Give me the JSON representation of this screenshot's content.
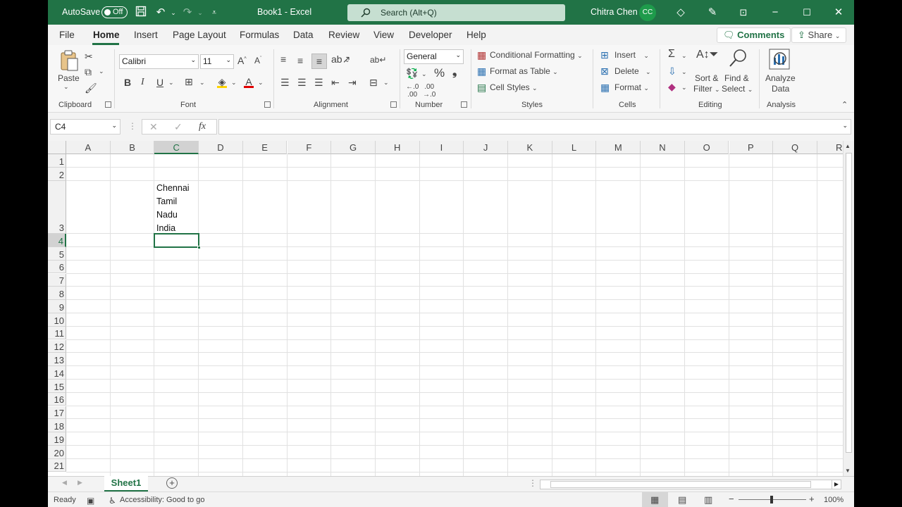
{
  "titlebar": {
    "autosave_label": "AutoSave",
    "autosave_state": "Off",
    "document_title": "Book1  -  Excel",
    "search_placeholder": "Search (Alt+Q)",
    "user_name": "Chitra Chen",
    "user_initials": "CC",
    "accent_color": "#217346"
  },
  "tabs": {
    "items": [
      "File",
      "Home",
      "Insert",
      "Page Layout",
      "Formulas",
      "Data",
      "Review",
      "View",
      "Developer",
      "Help"
    ],
    "active": "Home",
    "comments_label": "Comments",
    "share_label": "Share"
  },
  "ribbon": {
    "clipboard": {
      "paste": "Paste",
      "label": "Clipboard"
    },
    "font": {
      "family": "Calibri",
      "size": "11",
      "label": "Font",
      "bold": "B",
      "italic": "I",
      "underline": "U"
    },
    "alignment": {
      "label": "Alignment"
    },
    "number": {
      "format": "General",
      "label": "Number"
    },
    "styles": {
      "conditional": "Conditional Formatting",
      "format_table": "Format as Table",
      "cell_styles": "Cell Styles",
      "label": "Styles"
    },
    "cells": {
      "insert": "Insert",
      "delete": "Delete",
      "format": "Format",
      "label": "Cells"
    },
    "editing": {
      "sort1": "Sort &",
      "sort2": "Filter",
      "find1": "Find &",
      "find2": "Select",
      "label": "Editing"
    },
    "analysis": {
      "analyze1": "Analyze",
      "analyze2": "Data",
      "label": "Analysis"
    }
  },
  "formula_bar": {
    "name_box": "C4",
    "cancel": "✕",
    "enter": "✓",
    "fx": "fx",
    "formula": ""
  },
  "grid": {
    "columns": [
      "A",
      "B",
      "C",
      "D",
      "E",
      "F",
      "G",
      "H",
      "I",
      "J",
      "K",
      "L",
      "M",
      "N",
      "O",
      "P",
      "Q",
      "R"
    ],
    "rows": [
      "1",
      "2",
      "3",
      "4",
      "5",
      "6",
      "7",
      "8",
      "9",
      "10",
      "11",
      "12",
      "13",
      "14",
      "15",
      "16",
      "17",
      "18",
      "19",
      "20",
      "21"
    ],
    "selected_column": "C",
    "selected_row": "4",
    "cell_c3_lines": [
      "Chennai",
      "Tamil",
      "Nadu",
      "India"
    ]
  },
  "sheets": {
    "tabs": [
      "Sheet1"
    ],
    "active": "Sheet1",
    "add": "+"
  },
  "status": {
    "ready": "Ready",
    "accessibility": "Accessibility: Good to go",
    "zoom": "100%",
    "minus": "−",
    "plus": "+"
  }
}
